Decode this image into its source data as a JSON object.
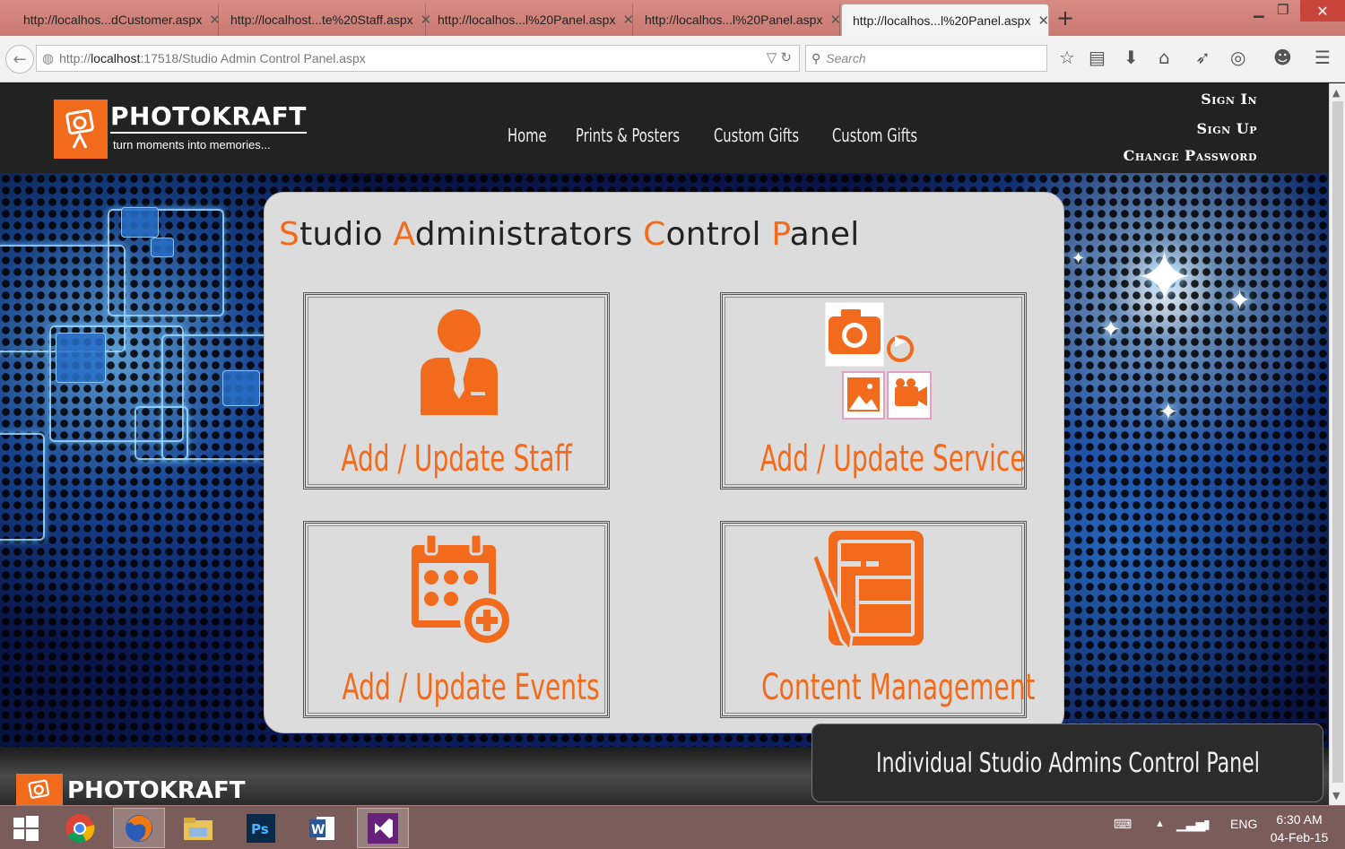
{
  "browser": {
    "tabs": [
      {
        "label": "http://localhos...dCustomer.aspx",
        "active": false
      },
      {
        "label": "http://localhost...te%20Staff.aspx",
        "active": false
      },
      {
        "label": "http://localhos...l%20Panel.aspx",
        "active": false
      },
      {
        "label": "http://localhos...l%20Panel.aspx",
        "active": false
      },
      {
        "label": "http://localhos...l%20Panel.aspx",
        "active": true
      }
    ],
    "url_scheme": "http://",
    "url_host": "localhost",
    "url_path": ":17518/Studio Admin Control Panel.aspx",
    "search_placeholder": "Search"
  },
  "header": {
    "brand": "PHOTOKRAFT",
    "tagline": "turn moments into memories...",
    "nav": [
      "Home",
      "Prints & Posters",
      "Custom Gifts",
      "Custom Gifts"
    ],
    "account_links": [
      "Sign In",
      "Sign Up",
      "Change Password"
    ]
  },
  "panel": {
    "title_parts": [
      {
        "cap": "S",
        "rest": "tudio "
      },
      {
        "cap": "A",
        "rest": "dministrators "
      },
      {
        "cap": "C",
        "rest": "ontrol "
      },
      {
        "cap": "P",
        "rest": "anel"
      }
    ],
    "cards": [
      {
        "label": "Add / Update Staff",
        "icon": "staff-icon"
      },
      {
        "label": "Add / Update Service",
        "icon": "service-icon"
      },
      {
        "label": "Add / Update Events",
        "icon": "calendar-add-icon"
      },
      {
        "label": "Content Management",
        "icon": "content-management-icon"
      }
    ]
  },
  "footer": {
    "brand": "PHOTOKRAFT"
  },
  "caption": "Individual Studio Admins Control Panel",
  "taskbar": {
    "language": "ENG",
    "time": "6:30 AM",
    "date": "04-Feb-15"
  },
  "colors": {
    "accent": "#f26b1d",
    "header_bg": "#222222",
    "panel_bg": "#dcdcdc"
  }
}
